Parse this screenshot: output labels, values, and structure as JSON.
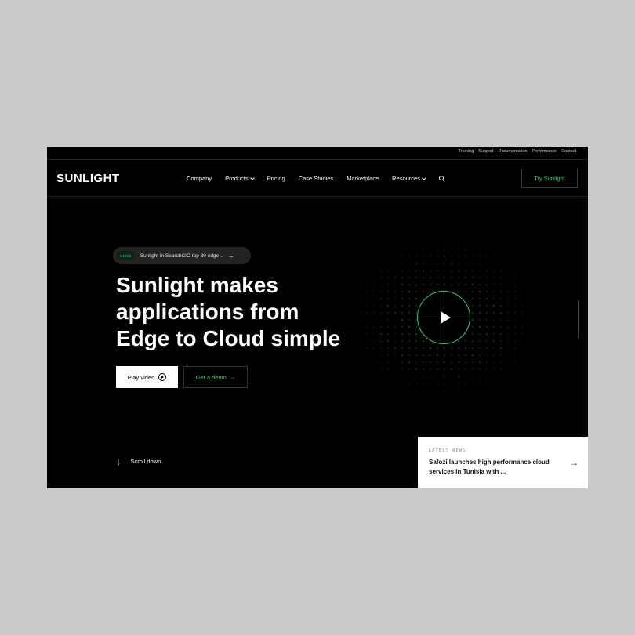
{
  "utility_links": [
    "Training",
    "Support",
    "Documentation",
    "Performance",
    "Contact"
  ],
  "brand": "SUNLIGHT",
  "nav": {
    "company": "Company",
    "products": "Products",
    "pricing": "Pricing",
    "case_studies": "Case Studies",
    "marketplace": "Marketplace",
    "resources": "Resources",
    "cta": "Try Sunlight"
  },
  "news_pill": {
    "tag": "NEWS",
    "text": "Sunlight in SearchCIO top 30 edge ..",
    "arrow": "→"
  },
  "hero": {
    "line1": "Sunlight makes",
    "line2": "applications from",
    "line3": "Edge to Cloud simple"
  },
  "buttons": {
    "play_video": "Play video",
    "get_demo": "Get a demo",
    "demo_arrow": "→"
  },
  "scroll": {
    "arrow": "↓",
    "label": "Scroll down"
  },
  "latest_news": {
    "eyebrow": "LATEST NEWS",
    "title": "Safozi launches high performance cloud services in Tunisia with ...",
    "arrow": "→"
  },
  "colors": {
    "background": "#000000",
    "page": "#cacaca",
    "accent": "#2fd06b",
    "text": "#ffffff"
  }
}
